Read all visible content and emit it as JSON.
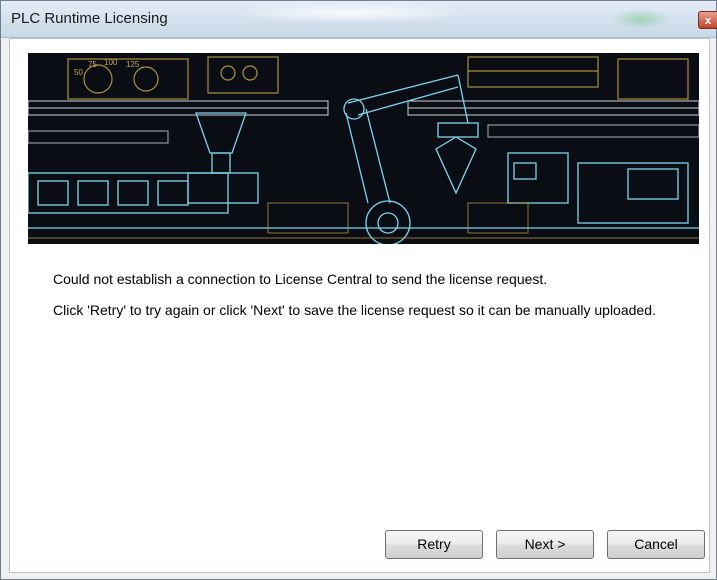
{
  "window": {
    "title": "PLC Runtime Licensing",
    "close_glyph": "x"
  },
  "banner": {
    "description_icon": "industrial-machinery-illustration",
    "gauge_labels": [
      "75",
      "100",
      "125",
      "50"
    ]
  },
  "message": {
    "line1": "Could not establish a connection to License Central to send the license request.",
    "line2": "Click 'Retry' to try again or click 'Next' to save the license request so it can be manually uploaded."
  },
  "buttons": {
    "retry": "Retry",
    "next": "Next >",
    "cancel": "Cancel"
  },
  "colors": {
    "banner_bg": "#0a0d14",
    "line_cyan": "#7fd3ec",
    "line_gold": "#c9a64a",
    "line_white": "#dfe8ef"
  }
}
